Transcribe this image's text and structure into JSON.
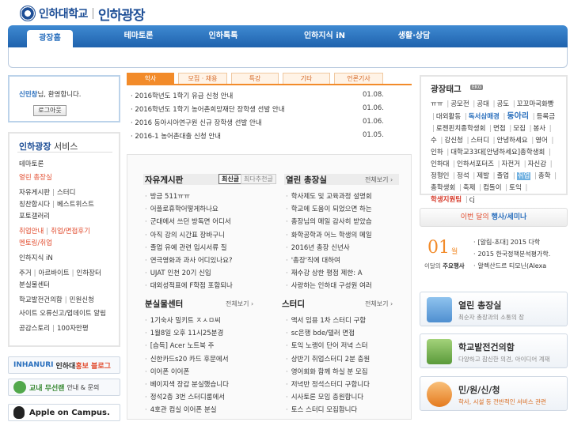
{
  "header": {
    "univ_name": "인하대학교",
    "site_name": "인하광장"
  },
  "nav": {
    "items": [
      "광장홈",
      "테마토론",
      "인하톡톡",
      "인하지식 iN",
      "생활·상담"
    ],
    "active": 0
  },
  "login": {
    "user_name": "신민창",
    "welcome_suffix": "님, 환영합니다.",
    "logout_label": "로그아웃"
  },
  "service": {
    "title": "인하광장",
    "title_suffix": " 서비스",
    "rows": [
      [
        {
          "t": "테마토론",
          "red": false
        }
      ],
      [
        {
          "t": "열린 총장실",
          "red": true
        }
      ],
      [
        {
          "t": "자유게시판",
          "red": false
        },
        {
          "t": "스터디",
          "red": false
        }
      ],
      [
        {
          "t": "칭찬합시다",
          "red": false
        },
        {
          "t": "베스트위스트",
          "red": false
        }
      ],
      [
        {
          "t": "포토갤러리",
          "red": false
        }
      ],
      [
        {
          "t": "취업안내",
          "red": true
        },
        {
          "t": "취업/면접후기",
          "red": true
        }
      ],
      [
        {
          "t": "멘토링/취업",
          "red": true
        }
      ],
      [
        {
          "t": "인하지식 iN",
          "red": false
        }
      ],
      [
        {
          "t": "주거",
          "red": false
        },
        {
          "t": "아르바이트",
          "red": false
        },
        {
          "t": "인하장터",
          "red": false
        }
      ],
      [
        {
          "t": "분실물센터",
          "red": false
        }
      ],
      [
        {
          "t": "학교발전건의함",
          "red": false
        },
        {
          "t": "민원신청",
          "red": false
        }
      ],
      [
        {
          "t": "사이트 오류신고/업데이트 알림",
          "red": false
        }
      ],
      [
        {
          "t": "공감스토리",
          "red": false
        },
        {
          "t": "100자만평",
          "red": false
        }
      ]
    ]
  },
  "banners": {
    "hongbo": {
      "p1": "INHANURI",
      "p2": "인하대",
      "p3": "홍보 블로그"
    },
    "wifi": {
      "p1": "교내 무선랜",
      "p2": "안내 & 문의"
    },
    "apple": {
      "label": "Apple on Campus."
    }
  },
  "notice": {
    "tabs": [
      "학사",
      "모집 · 채용",
      "특강",
      "기타",
      "언론기사"
    ],
    "active": 0,
    "items": [
      {
        "title": "2016학년도 1학기 유급 신청 안내",
        "date": "01.08."
      },
      {
        "title": "2016학년도 1학기 농어촌희망재단 장학생 선발 안내",
        "date": "01.06."
      },
      {
        "title": "2016 동아시아연구원 신규 장학생 선발 안내",
        "date": "01.06."
      },
      {
        "title": "2016-1 농어촌대출 신청 안내",
        "date": "01.05."
      }
    ]
  },
  "boards": {
    "free": {
      "title": "자유게시판",
      "tab_on": "최신글",
      "tab_off": "최다추천글",
      "items": [
        "방금 511ㅠㅠ",
        "어플로휴학어떻게하나요",
        "군대에서 쓰던 방독면 어디서",
        "아직 강의 시간표 장바구니",
        "졸업 유예 관련 입시서류 질",
        "연극영화과 과사 어디있나요?",
        "UJAT 인천 20기 신입",
        "대외성적표에 F학점 포함되나"
      ]
    },
    "president": {
      "title": "열린 총장실",
      "more": "전체보기",
      "items": [
        "학사제도 및 교육과정 설명회",
        "학교에 도움이 되었으면 하는",
        "총장님의 메일 감사히 받았습",
        "화학공학과 어느 학생의 메일",
        "2016년 총장 신년사",
        "'총장'직에 대하여",
        "재수강 상한 평점 제한: A",
        "사랑하는 인하대 구성원 여러"
      ]
    },
    "lost": {
      "title": "분실물센터",
      "more": "전체보기",
      "items": [
        "1기숙사 밀키트 ㅈㅅㅁ씨",
        "1월8일 오후 11시25분경",
        "[습득] Acer 노트북 주",
        "신한카드s20 카드 후문에서",
        "이어폰 이어폰",
        "베이지색 장갑 분실했습니다",
        "정석2층 3번 스터디룸에서",
        "4호관 컴실 이어폰 분실"
      ]
    },
    "study": {
      "title": "스터디",
      "more": "전체보기",
      "items": [
        "액서 임용 1차 스터디 구함",
        "sc은행 bde/텔러 면접",
        "토익 노랭이 단어 저녁 스터",
        "상반기 취업스터디 2분 충원",
        "영어회화 함께 하실 분 모집",
        "저녁반 정석스터디 구합니다",
        "시사토론 모임 충원합니다",
        "토스 스터디 모집합니다"
      ]
    }
  },
  "tags": {
    "title": "광장태그",
    "new_badge": "EKG",
    "items": [
      {
        "t": "ㅠㅠ",
        "s": ""
      },
      {
        "t": "공모전",
        "s": ""
      },
      {
        "t": "공대",
        "s": ""
      },
      {
        "t": "공도",
        "s": ""
      },
      {
        "t": "꼬꼬마국화빵",
        "s": ""
      },
      {
        "t": "대외활동",
        "s": ""
      },
      {
        "t": "독서삼매경",
        "s": "hl-blue"
      },
      {
        "t": "동아리",
        "s": "hl-blue2"
      },
      {
        "t": "등록금",
        "s": ""
      },
      {
        "t": "로젠핀치종학생회",
        "s": ""
      },
      {
        "t": "면접",
        "s": ""
      },
      {
        "t": "모집",
        "s": ""
      },
      {
        "t": "봉사",
        "s": ""
      },
      {
        "t": "수",
        "s": ""
      },
      {
        "t": "강신청",
        "s": ""
      },
      {
        "t": "스터디",
        "s": ""
      },
      {
        "t": "안녕하세요",
        "s": ""
      },
      {
        "t": "영어",
        "s": ""
      },
      {
        "t": "인하",
        "s": ""
      },
      {
        "t": "대학교33대[안녕하세요]총학생회",
        "s": ""
      },
      {
        "t": "인하대",
        "s": ""
      },
      {
        "t": "인하서포터즈",
        "s": ""
      },
      {
        "t": "자전거",
        "s": ""
      },
      {
        "t": "자신감",
        "s": ""
      },
      {
        "t": "정형인",
        "s": ""
      },
      {
        "t": "정석",
        "s": ""
      },
      {
        "t": "제발",
        "s": ""
      },
      {
        "t": "졸업",
        "s": ""
      },
      {
        "t": "취업",
        "s": "hl-box"
      },
      {
        "t": "총학",
        "s": ""
      },
      {
        "t": "총학생회",
        "s": ""
      },
      {
        "t": "축제",
        "s": ""
      },
      {
        "t": "컴돌이",
        "s": ""
      },
      {
        "t": "토익",
        "s": ""
      },
      {
        "t": "학생지원팀",
        "s": "hl-red"
      },
      {
        "t": "cj",
        "s": ""
      }
    ]
  },
  "events": {
    "title_p1": "이번 달의",
    "title_p2": "행사/세미나",
    "month": "01",
    "month_unit": "월",
    "label_p1": "이달의",
    "label_p2": "주요행사",
    "items": [
      "[알림-초대] 2015 다학",
      "2015 한국정책분석평가학.",
      "알렉산드르 티모닌(Alexa"
    ]
  },
  "right_banners": [
    {
      "title": "열린 총장실",
      "sub": "최순자 총장과의 소통의 장"
    },
    {
      "title": "학교발전건의함",
      "sub": "다양하고 참신한 의견, 아이디어 계재"
    },
    {
      "title": "민/원/신/청",
      "sub": "학사, 시설 등 전반적인 서비스 관련"
    }
  ]
}
